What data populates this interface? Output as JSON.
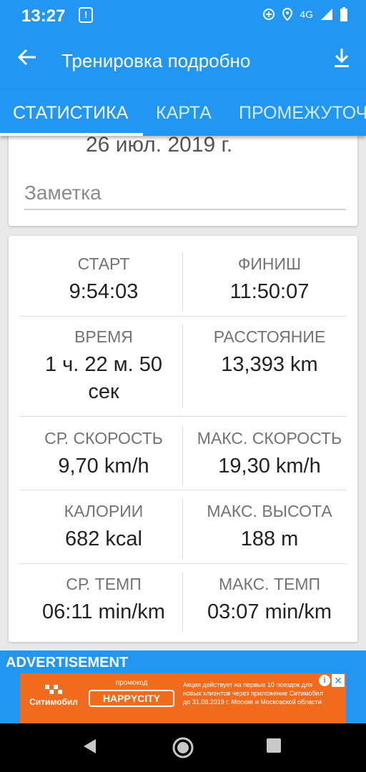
{
  "status": {
    "time": "13:27",
    "network": "4G"
  },
  "header": {
    "title": "Тренировка подробно"
  },
  "tabs": [
    {
      "label": "СТАТИСТИКА",
      "active": true
    },
    {
      "label": "КАРТА",
      "active": false
    },
    {
      "label": "ПРОМЕЖУТОЧ",
      "active": false
    }
  ],
  "summary": {
    "date": "26 июл. 2019 г.",
    "note_placeholder": "Заметка"
  },
  "stats": [
    {
      "label": "СТАРТ",
      "value": "9:54:03"
    },
    {
      "label": "ФИНИШ",
      "value": "11:50:07"
    },
    {
      "label": "ВРЕМЯ",
      "value": "1 ч. 22 м. 50 сек"
    },
    {
      "label": "РАССТОЯНИЕ",
      "value": "13,393 km"
    },
    {
      "label": "СР. СКОРОСТЬ",
      "value": "9,70 km/h"
    },
    {
      "label": "МАКС. СКОРОСТЬ",
      "value": "19,30 km/h"
    },
    {
      "label": "КАЛОРИИ",
      "value": "682 kcal"
    },
    {
      "label": "МАКС. ВЫСОТА",
      "value": "188 m"
    },
    {
      "label": "СР. ТЕМП",
      "value": "06:11 min/km"
    },
    {
      "label": "МАКС. ТЕМП",
      "value": "03:07 min/km"
    }
  ],
  "ad": {
    "label": "ADVERTISEMENT",
    "brand": "Ситимобил",
    "promo_label": "промокод",
    "promo_code": "HAPPYCITY",
    "text": "Акция действует на первые 10 поездок для новых клиентов через приложение Ситимобил до 31.08.2019 г. Москве и Московской области"
  },
  "colors": {
    "primary": "#2196f3",
    "ad_banner": "#f26b1d"
  }
}
